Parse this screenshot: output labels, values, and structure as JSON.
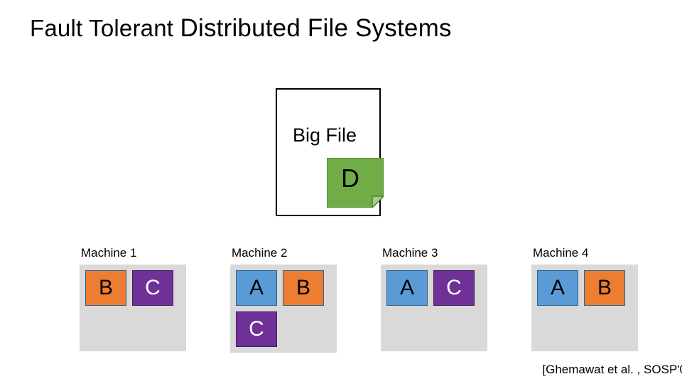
{
  "title": {
    "prefix": "Fault Tolerant ",
    "main": "Distributed File Systems"
  },
  "bigfile": {
    "label": "Big File",
    "block": "D"
  },
  "machines": [
    {
      "label": "Machine 1",
      "blocks": [
        "B",
        "C"
      ]
    },
    {
      "label": "Machine 2",
      "blocks": [
        "A",
        "B",
        "C"
      ]
    },
    {
      "label": "Machine 3",
      "blocks": [
        "A",
        "C"
      ]
    },
    {
      "label": "Machine 4",
      "blocks": [
        "A",
        "B"
      ]
    }
  ],
  "citation": "[Ghemawat et al. , SOSP'0",
  "colors": {
    "A": "#5b9bd5",
    "B": "#ed7d31",
    "C": "#6f3198",
    "D": "#70ad47",
    "machine_bg": "#d9d9d9"
  }
}
